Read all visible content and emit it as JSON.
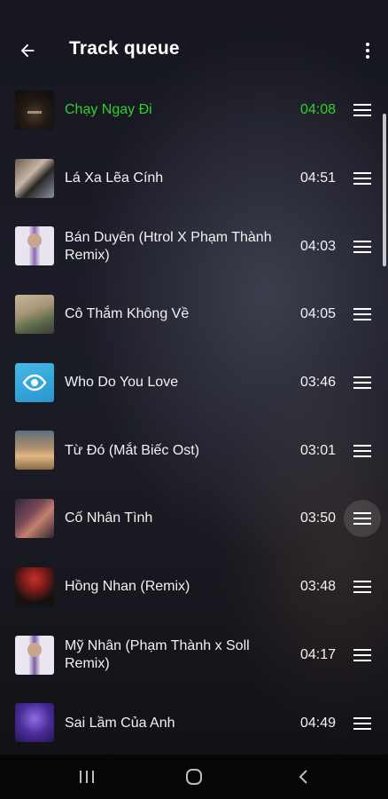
{
  "header": {
    "title": "Track queue"
  },
  "icons": {
    "back": "arrow-left-icon",
    "more": "more-vertical-icon",
    "drag": "drag-handle-icon"
  },
  "colors": {
    "accent": "#2fd12f",
    "text": "#f2f2f2",
    "navbar": "#060607"
  },
  "queue": [
    {
      "title": "Chạy Ngay Đi",
      "duration": "04:08",
      "playing": true
    },
    {
      "title": "Lá Xa Lẽa Cính",
      "duration": "04:51"
    },
    {
      "title": "Bán Duyên (Htrol X Phạm Thành Remix)",
      "duration": "04:03"
    },
    {
      "title": "Cô Thắm Không Về",
      "duration": "04:05"
    },
    {
      "title": "Who Do You Love",
      "duration": "03:46"
    },
    {
      "title": "Từ Đó (Mắt Biếc Ost)",
      "duration": "03:01"
    },
    {
      "title": "Cố Nhân Tình",
      "duration": "03:50"
    },
    {
      "title": "Hồng Nhan (Remix)",
      "duration": "03:48"
    },
    {
      "title": "Mỹ Nhân (Phạm Thành x Soll Remix)",
      "duration": "04:17"
    },
    {
      "title": "Sai Lầm Của Anh",
      "duration": "04:49"
    }
  ],
  "navbar": {
    "recents": "recents-icon",
    "home": "home-icon",
    "back": "nav-back-icon"
  }
}
